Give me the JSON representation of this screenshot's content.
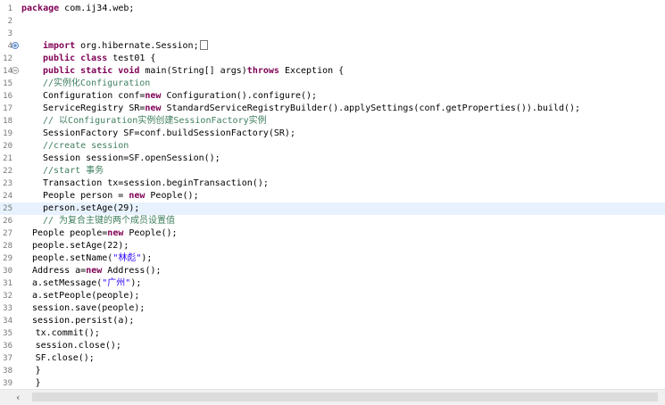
{
  "editor": {
    "language": "java",
    "highlighted_line": "25",
    "colors": {
      "keyword": "#7f0055",
      "comment": "#3f7f5f",
      "string": "#2a00ff",
      "current_line": "#e8f2fe"
    },
    "lines": [
      {
        "n": "1",
        "indent": 0,
        "segs": [
          {
            "t": "package",
            "c": "kw"
          },
          {
            "t": " com.ij34.web;"
          }
        ]
      },
      {
        "n": "2",
        "indent": 0,
        "segs": []
      },
      {
        "n": "3",
        "indent": 0,
        "segs": []
      },
      {
        "n": "4",
        "indent": 2,
        "marker": "expand",
        "segs": [
          {
            "t": "import",
            "c": "kw"
          },
          {
            "t": " org.hibernate.Session;"
          }
        ],
        "fold": true
      },
      {
        "n": "12",
        "indent": 2,
        "segs": [
          {
            "t": "public class",
            "c": "kw"
          },
          {
            "t": " test01 {"
          }
        ]
      },
      {
        "n": "14",
        "indent": 2,
        "marker": "collapse",
        "segs": [
          {
            "t": "public static void",
            "c": "kw"
          },
          {
            "t": " main(String[] args)"
          },
          {
            "t": "throws",
            "c": "kw"
          },
          {
            "t": " Exception {"
          }
        ]
      },
      {
        "n": "15",
        "indent": 2,
        "segs": [
          {
            "t": "//实例化Configuration",
            "c": "cm"
          }
        ]
      },
      {
        "n": "16",
        "indent": 2,
        "segs": [
          {
            "t": "Configuration conf="
          },
          {
            "t": "new",
            "c": "kw"
          },
          {
            "t": " Configuration().configure();"
          }
        ]
      },
      {
        "n": "17",
        "indent": 2,
        "segs": [
          {
            "t": "ServiceRegistry SR="
          },
          {
            "t": "new",
            "c": "kw"
          },
          {
            "t": " StandardServiceRegistryBuilder().applySettings(conf.getProperties()).build();"
          }
        ]
      },
      {
        "n": "18",
        "indent": 2,
        "segs": [
          {
            "t": "// 以Configuration实例创建SessionFactory实例",
            "c": "cm"
          }
        ]
      },
      {
        "n": "19",
        "indent": 2,
        "segs": [
          {
            "t": "SessionFactory SF=conf.buildSessionFactory(SR);"
          }
        ]
      },
      {
        "n": "20",
        "indent": 2,
        "segs": [
          {
            "t": "//create session",
            "c": "cm"
          }
        ]
      },
      {
        "n": "21",
        "indent": 2,
        "segs": [
          {
            "t": "Session session=SF.openSession();"
          }
        ]
      },
      {
        "n": "22",
        "indent": 2,
        "segs": [
          {
            "t": "//start 事务",
            "c": "cm"
          }
        ]
      },
      {
        "n": "23",
        "indent": 2,
        "segs": [
          {
            "t": "Transaction tx=session.beginTransaction();"
          }
        ]
      },
      {
        "n": "24",
        "indent": 2,
        "segs": [
          {
            "t": "People person = "
          },
          {
            "t": "new",
            "c": "kw"
          },
          {
            "t": " People();"
          }
        ]
      },
      {
        "n": "25",
        "indent": 2,
        "segs": [
          {
            "t": "person.setAge(29);"
          }
        ]
      },
      {
        "n": "26",
        "indent": 2,
        "segs": [
          {
            "t": "// 为复合主键的两个成员设置值",
            "c": "cm"
          }
        ]
      },
      {
        "n": "27",
        "indent": 1,
        "segs": [
          {
            "t": "People people="
          },
          {
            "t": "new",
            "c": "kw"
          },
          {
            "t": " People();"
          }
        ]
      },
      {
        "n": "28",
        "indent": 1,
        "segs": [
          {
            "t": "people.setAge(22);"
          }
        ]
      },
      {
        "n": "29",
        "indent": 1,
        "segs": [
          {
            "t": "people.setName("
          },
          {
            "t": "\"林彪\"",
            "c": "str"
          },
          {
            "t": ");"
          }
        ]
      },
      {
        "n": "30",
        "indent": 1,
        "segs": [
          {
            "t": "Address a="
          },
          {
            "t": "new",
            "c": "kw"
          },
          {
            "t": " Address();"
          }
        ]
      },
      {
        "n": "31",
        "indent": 1,
        "segs": [
          {
            "t": "a.setMessage("
          },
          {
            "t": "\"广州\"",
            "c": "str"
          },
          {
            "t": ");"
          }
        ]
      },
      {
        "n": "32",
        "indent": 1,
        "segs": [
          {
            "t": "a.setPeople(people);"
          }
        ]
      },
      {
        "n": "33",
        "indent": 1,
        "segs": [
          {
            "t": "session.save(people);"
          }
        ]
      },
      {
        "n": "34",
        "indent": 1,
        "segs": [
          {
            "t": "session.persist(a);"
          }
        ]
      },
      {
        "n": "35",
        "indent": 1.3,
        "segs": [
          {
            "t": "tx.commit();"
          }
        ]
      },
      {
        "n": "36",
        "indent": 1.3,
        "segs": [
          {
            "t": "session.close();"
          }
        ]
      },
      {
        "n": "37",
        "indent": 1.3,
        "segs": [
          {
            "t": "SF.close();"
          }
        ]
      },
      {
        "n": "38",
        "indent": 1.3,
        "segs": [
          {
            "t": "}"
          }
        ]
      },
      {
        "n": "39",
        "indent": 1.3,
        "segs": [
          {
            "t": "}"
          }
        ]
      }
    ]
  },
  "scrollbar": {
    "left_arrow_icon": "chevron-left-icon",
    "left_arrow_glyph": "‹"
  }
}
